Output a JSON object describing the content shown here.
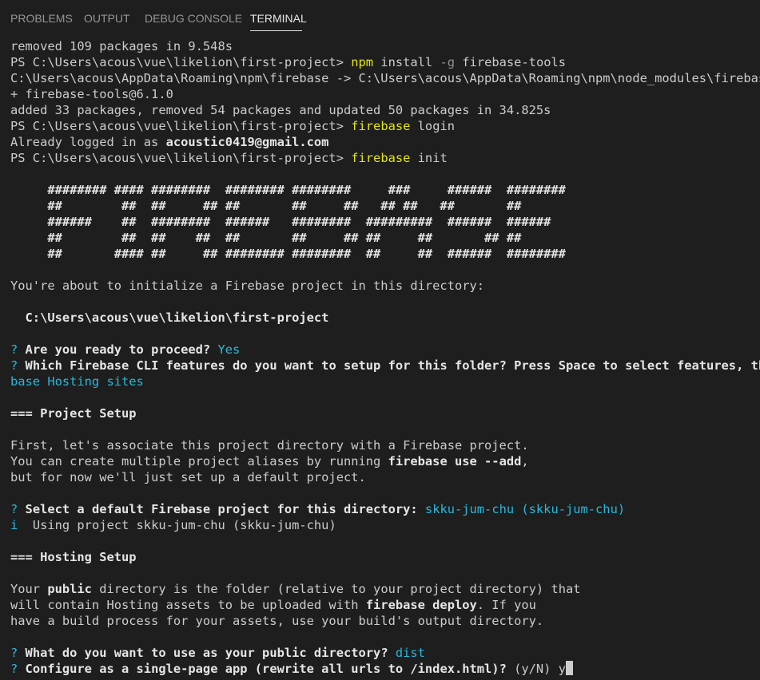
{
  "panel": {
    "tabs": [
      {
        "label": "PROBLEMS"
      },
      {
        "label": "OUTPUT"
      },
      {
        "label": "DEBUG CONSOLE"
      },
      {
        "label": "TERMINAL"
      }
    ],
    "active_tab": "TERMINAL"
  },
  "terminal": {
    "prompt": "PS C:\\Users\\acous\\vue\\likelion\\first-project>",
    "l01": "removed 109 packages in 9.548s",
    "l02_cmd": "npm",
    "l02_args": " install ",
    "l02_flag": "-g",
    "l02_tail": " firebase-tools",
    "l03": "C:\\Users\\acous\\AppData\\Roaming\\npm\\firebase -> C:\\Users\\acous\\AppData\\Roaming\\npm\\node_modules\\firebase-t",
    "l04": "+ firebase-tools@6.1.0",
    "l05": "added 33 packages, removed 54 packages and updated 50 packages in 34.825s",
    "l06_cmd": "firebase",
    "l06_args": " login",
    "l07_pre": "Already logged in as ",
    "l07_email": "acoustic0419@gmail.com",
    "l08_cmd": "firebase",
    "l08_args": " init",
    "banner": [
      "     ######## #### ########  ######## ########     ###     ######  ########",
      "     ##        ##  ##     ## ##       ##     ##   ## ##   ##       ##",
      "     ######    ##  ########  ######   ########  #########  ######  ######",
      "     ##        ##  ##    ##  ##       ##     ## ##     ##       ## ##",
      "     ##       #### ##     ## ######## ########  ##     ##  ######  ########"
    ],
    "init_msg": "You're about to initialize a Firebase project in this directory:",
    "project_dir": "  C:\\Users\\acous\\vue\\likelion\\first-project",
    "q_mark": "?",
    "q1": " Are you ready to proceed?",
    "a1": " Yes",
    "q2": " Which Firebase CLI features do you want to setup for this folder? Press Space to select features, then",
    "a2_wrap": "base Hosting sites",
    "project_setup": "=== Project Setup",
    "ps1": "First, let's associate this project directory with a Firebase project.",
    "ps2_pre": "You can create multiple project aliases by running ",
    "ps2_bold": "firebase use --add",
    "ps2_post": ",",
    "ps3": "but for now we'll just set up a default project.",
    "q3": " Select a default Firebase project for this directory:",
    "a3": " skku-jum-chu (skku-jum-chu)",
    "info_mark": "i",
    "info": "  Using project skku-jum-chu (skku-jum-chu)",
    "hosting_setup": "=== Hosting Setup",
    "h1_pre": "Your ",
    "h1_bold": "public",
    "h1_post": " directory is the folder (relative to your project directory) that",
    "h2_pre": "will contain Hosting assets to be uploaded with ",
    "h2_bold": "firebase deploy",
    "h2_post": ". If you",
    "h3": "have a build process for your assets, use your build's output directory.",
    "q4": " What do you want to use as your public directory?",
    "a4": " dist",
    "q5": " Configure as a single-page app (rewrite all urls to /index.html)?",
    "q5_hint": " (y/N)",
    "q5_input": " y"
  }
}
